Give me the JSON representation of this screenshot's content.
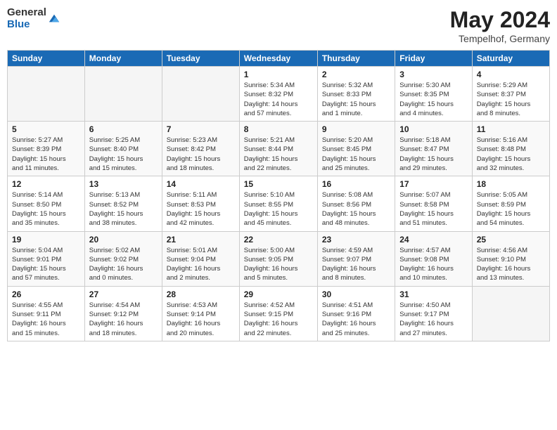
{
  "header": {
    "logo_general": "General",
    "logo_blue": "Blue",
    "month_title": "May 2024",
    "location": "Tempelhof, Germany"
  },
  "days_of_week": [
    "Sunday",
    "Monday",
    "Tuesday",
    "Wednesday",
    "Thursday",
    "Friday",
    "Saturday"
  ],
  "weeks": [
    [
      {
        "day": "",
        "info": ""
      },
      {
        "day": "",
        "info": ""
      },
      {
        "day": "",
        "info": ""
      },
      {
        "day": "1",
        "info": "Sunrise: 5:34 AM\nSunset: 8:32 PM\nDaylight: 14 hours\nand 57 minutes."
      },
      {
        "day": "2",
        "info": "Sunrise: 5:32 AM\nSunset: 8:33 PM\nDaylight: 15 hours\nand 1 minute."
      },
      {
        "day": "3",
        "info": "Sunrise: 5:30 AM\nSunset: 8:35 PM\nDaylight: 15 hours\nand 4 minutes."
      },
      {
        "day": "4",
        "info": "Sunrise: 5:29 AM\nSunset: 8:37 PM\nDaylight: 15 hours\nand 8 minutes."
      }
    ],
    [
      {
        "day": "5",
        "info": "Sunrise: 5:27 AM\nSunset: 8:39 PM\nDaylight: 15 hours\nand 11 minutes."
      },
      {
        "day": "6",
        "info": "Sunrise: 5:25 AM\nSunset: 8:40 PM\nDaylight: 15 hours\nand 15 minutes."
      },
      {
        "day": "7",
        "info": "Sunrise: 5:23 AM\nSunset: 8:42 PM\nDaylight: 15 hours\nand 18 minutes."
      },
      {
        "day": "8",
        "info": "Sunrise: 5:21 AM\nSunset: 8:44 PM\nDaylight: 15 hours\nand 22 minutes."
      },
      {
        "day": "9",
        "info": "Sunrise: 5:20 AM\nSunset: 8:45 PM\nDaylight: 15 hours\nand 25 minutes."
      },
      {
        "day": "10",
        "info": "Sunrise: 5:18 AM\nSunset: 8:47 PM\nDaylight: 15 hours\nand 29 minutes."
      },
      {
        "day": "11",
        "info": "Sunrise: 5:16 AM\nSunset: 8:48 PM\nDaylight: 15 hours\nand 32 minutes."
      }
    ],
    [
      {
        "day": "12",
        "info": "Sunrise: 5:14 AM\nSunset: 8:50 PM\nDaylight: 15 hours\nand 35 minutes."
      },
      {
        "day": "13",
        "info": "Sunrise: 5:13 AM\nSunset: 8:52 PM\nDaylight: 15 hours\nand 38 minutes."
      },
      {
        "day": "14",
        "info": "Sunrise: 5:11 AM\nSunset: 8:53 PM\nDaylight: 15 hours\nand 42 minutes."
      },
      {
        "day": "15",
        "info": "Sunrise: 5:10 AM\nSunset: 8:55 PM\nDaylight: 15 hours\nand 45 minutes."
      },
      {
        "day": "16",
        "info": "Sunrise: 5:08 AM\nSunset: 8:56 PM\nDaylight: 15 hours\nand 48 minutes."
      },
      {
        "day": "17",
        "info": "Sunrise: 5:07 AM\nSunset: 8:58 PM\nDaylight: 15 hours\nand 51 minutes."
      },
      {
        "day": "18",
        "info": "Sunrise: 5:05 AM\nSunset: 8:59 PM\nDaylight: 15 hours\nand 54 minutes."
      }
    ],
    [
      {
        "day": "19",
        "info": "Sunrise: 5:04 AM\nSunset: 9:01 PM\nDaylight: 15 hours\nand 57 minutes."
      },
      {
        "day": "20",
        "info": "Sunrise: 5:02 AM\nSunset: 9:02 PM\nDaylight: 16 hours\nand 0 minutes."
      },
      {
        "day": "21",
        "info": "Sunrise: 5:01 AM\nSunset: 9:04 PM\nDaylight: 16 hours\nand 2 minutes."
      },
      {
        "day": "22",
        "info": "Sunrise: 5:00 AM\nSunset: 9:05 PM\nDaylight: 16 hours\nand 5 minutes."
      },
      {
        "day": "23",
        "info": "Sunrise: 4:59 AM\nSunset: 9:07 PM\nDaylight: 16 hours\nand 8 minutes."
      },
      {
        "day": "24",
        "info": "Sunrise: 4:57 AM\nSunset: 9:08 PM\nDaylight: 16 hours\nand 10 minutes."
      },
      {
        "day": "25",
        "info": "Sunrise: 4:56 AM\nSunset: 9:10 PM\nDaylight: 16 hours\nand 13 minutes."
      }
    ],
    [
      {
        "day": "26",
        "info": "Sunrise: 4:55 AM\nSunset: 9:11 PM\nDaylight: 16 hours\nand 15 minutes."
      },
      {
        "day": "27",
        "info": "Sunrise: 4:54 AM\nSunset: 9:12 PM\nDaylight: 16 hours\nand 18 minutes."
      },
      {
        "day": "28",
        "info": "Sunrise: 4:53 AM\nSunset: 9:14 PM\nDaylight: 16 hours\nand 20 minutes."
      },
      {
        "day": "29",
        "info": "Sunrise: 4:52 AM\nSunset: 9:15 PM\nDaylight: 16 hours\nand 22 minutes."
      },
      {
        "day": "30",
        "info": "Sunrise: 4:51 AM\nSunset: 9:16 PM\nDaylight: 16 hours\nand 25 minutes."
      },
      {
        "day": "31",
        "info": "Sunrise: 4:50 AM\nSunset: 9:17 PM\nDaylight: 16 hours\nand 27 minutes."
      },
      {
        "day": "",
        "info": ""
      }
    ]
  ]
}
